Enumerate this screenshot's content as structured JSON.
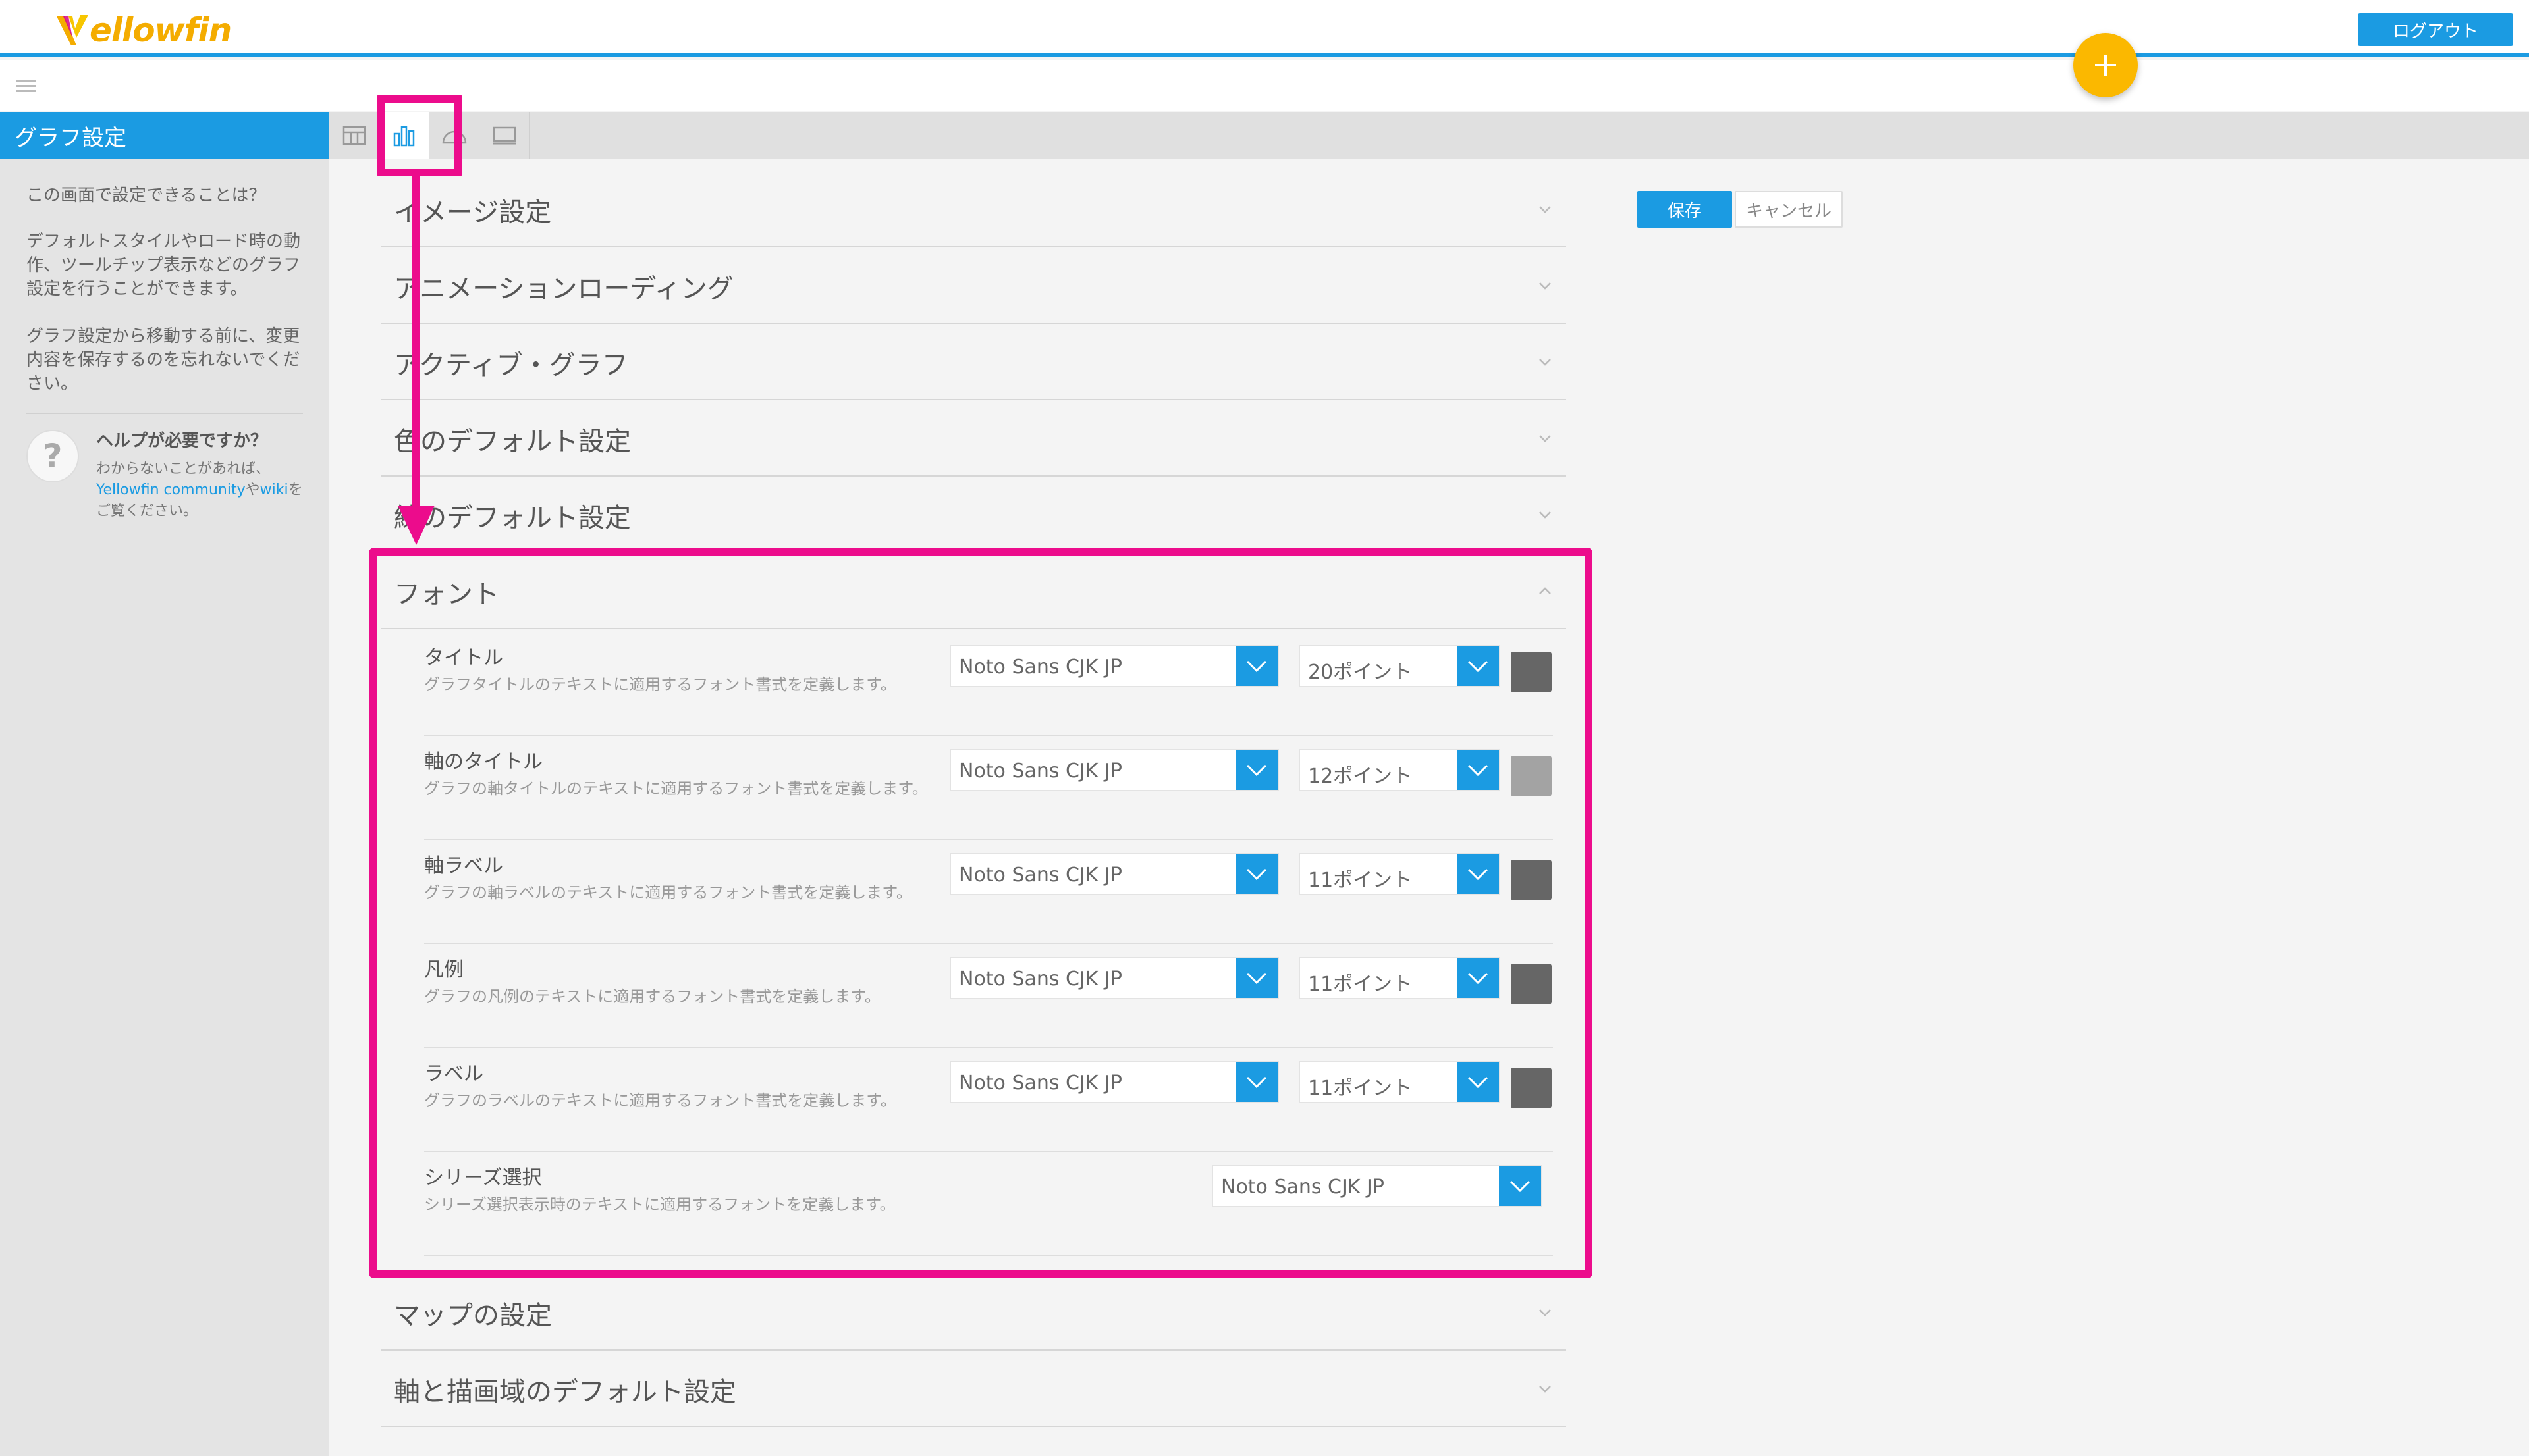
{
  "app": {
    "logo_text": "ellowfin",
    "logout_label": "ログアウト",
    "fab_icon": "plus-icon",
    "accent_color": "#1b9be2",
    "highlight_color": "#ec0c8c"
  },
  "sidebar": {
    "title": "グラフ設定",
    "question": "この画面で設定できることは？",
    "paragraph1": "デフォルトスタイルやロード時の動作、ツールチップ表示などのグラフ設定を行うことができます。",
    "paragraph2": "グラフ設定から移動する前に、変更内容を保存するのを忘れないでください。",
    "help": {
      "title": "ヘルプが必要ですか？",
      "text_before": "わからないことがあれば、",
      "link1": "Yellowfin community",
      "text_middle": "や",
      "link2": "wiki",
      "text_after": "をご覧ください。"
    }
  },
  "tabs": [
    {
      "icon": "table-icon"
    },
    {
      "icon": "bar-chart-icon"
    },
    {
      "icon": "gauge-icon"
    },
    {
      "icon": "monitor-icon"
    }
  ],
  "actions": {
    "save_label": "保存",
    "cancel_label": "キャンセル"
  },
  "sections": [
    {
      "title": "イメージ設定",
      "expanded": false
    },
    {
      "title": "アニメーションローディング",
      "expanded": false
    },
    {
      "title": "アクティブ・グラフ",
      "expanded": false
    },
    {
      "title": "色のデフォルト設定",
      "expanded": false
    },
    {
      "title": "線のデフォルト設定",
      "expanded": false
    },
    {
      "title": "フォント",
      "expanded": true
    },
    {
      "title": "マップの設定",
      "expanded": false
    },
    {
      "title": "軸と描画域のデフォルト設定",
      "expanded": false
    }
  ],
  "font_settings": [
    {
      "label": "タイトル",
      "desc": "グラフタイトルのテキストに適用するフォント書式を定義します。",
      "font": "Noto Sans CJK JP",
      "size": "20ポイント",
      "color": "#666666"
    },
    {
      "label": "軸のタイトル",
      "desc": "グラフの軸タイトルのテキストに適用するフォント書式を定義します。",
      "font": "Noto Sans CJK JP",
      "size": "12ポイント",
      "color": "#a3a3a3"
    },
    {
      "label": "軸ラベル",
      "desc": "グラフの軸ラベルのテキストに適用するフォント書式を定義します。",
      "font": "Noto Sans CJK JP",
      "size": "11ポイント",
      "color": "#666666"
    },
    {
      "label": "凡例",
      "desc": "グラフの凡例のテキストに適用するフォント書式を定義します。",
      "font": "Noto Sans CJK JP",
      "size": "11ポイント",
      "color": "#666666"
    },
    {
      "label": "ラベル",
      "desc": "グラフのラベルのテキストに適用するフォント書式を定義します。",
      "font": "Noto Sans CJK JP",
      "size": "11ポイント",
      "color": "#666666"
    },
    {
      "label": "シリーズ選択",
      "desc": "シリーズ選択表示時のテキストに適用するフォントを定義します。",
      "font": "Noto Sans CJK JP"
    }
  ]
}
